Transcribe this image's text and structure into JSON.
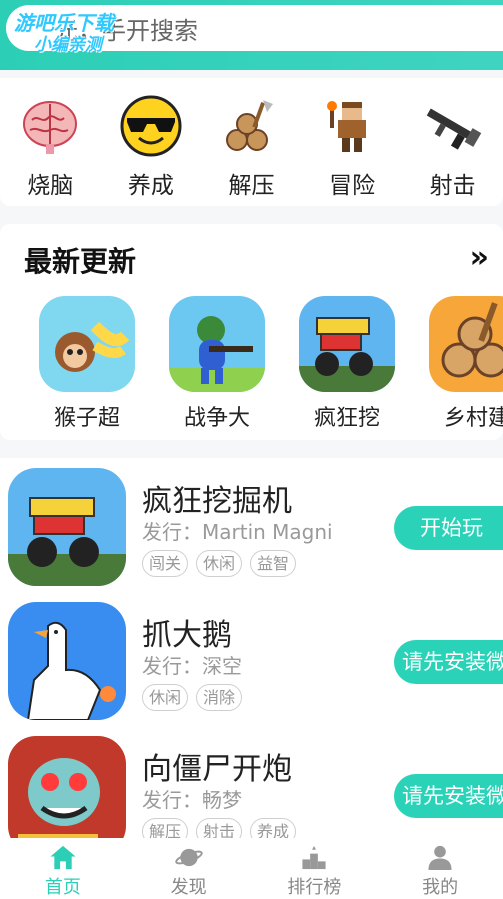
{
  "watermark": {
    "line1": "游吧乐下载",
    "line2": "小编亲测"
  },
  "search": {
    "placeholder": "ˇ光，手开搜索"
  },
  "categories": [
    {
      "label": "烧脑",
      "icon": "brain-icon"
    },
    {
      "label": "养成",
      "icon": "sunglasses-face-icon"
    },
    {
      "label": "解压",
      "icon": "logs-axe-icon"
    },
    {
      "label": "冒险",
      "icon": "adventurer-icon"
    },
    {
      "label": "射击",
      "icon": "rifle-icon"
    }
  ],
  "latest": {
    "title": "最新更新",
    "more": "»",
    "games": [
      {
        "name": "猴子超",
        "icon": "monkey-icon"
      },
      {
        "name": "战争大",
        "icon": "soldier-icon"
      },
      {
        "name": "疯狂挖",
        "icon": "truck-icon"
      },
      {
        "name": "乡村建",
        "icon": "logs-icon"
      }
    ]
  },
  "list": [
    {
      "name": "疯狂挖掘机",
      "publisher": "发行：Martin Magni",
      "tags": [
        "闯关",
        "休闲",
        "益智"
      ],
      "action": "开始玩",
      "icon": "excavator-truck-icon"
    },
    {
      "name": "抓大鹅",
      "publisher": "发行：深空",
      "tags": [
        "休闲",
        "消除"
      ],
      "action": "请先安装微",
      "icon": "goose-icon"
    },
    {
      "name": "向僵尸开炮",
      "publisher": "发行：畅梦",
      "tags": [
        "解压",
        "射击",
        "养成"
      ],
      "action": "请先安装微",
      "icon": "zombie-icon"
    }
  ],
  "nav": [
    {
      "label": "首页",
      "icon": "home-icon",
      "active": true
    },
    {
      "label": "发现",
      "icon": "planet-icon",
      "active": false
    },
    {
      "label": "排行榜",
      "icon": "podium-icon",
      "active": false
    },
    {
      "label": "我的",
      "icon": "user-icon",
      "active": false
    }
  ],
  "colors": {
    "accent": "#2ccfb6",
    "button": "#2ad3b8"
  }
}
